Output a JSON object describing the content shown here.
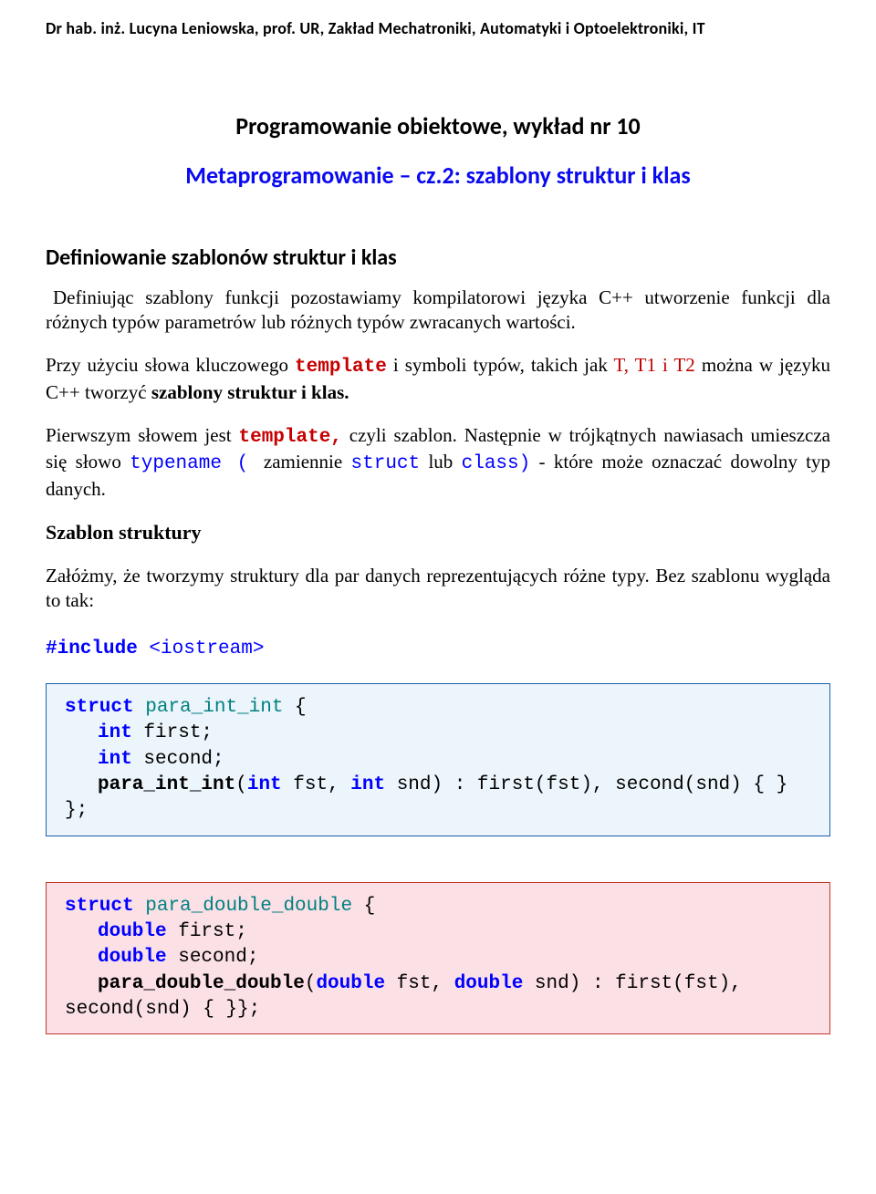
{
  "header": "Dr hab. inż. Lucyna Leniowska, prof. UR, Zakład Mechatroniki, Automatyki i Optoelektroniki, IT",
  "title": "Programowanie obiektowe, wykład nr 10",
  "subtitle": "Metaprogramowanie – cz.2: szablony struktur i klas",
  "section1": "Definiowanie szablonów struktur i klas",
  "p1": "Definiując szablony funkcji pozostawiamy kompilatorowi języka C++ utworzenie funkcji dla różnych typów parametrów lub różnych typów zwracanych wartości.",
  "p2a": "Przy użyciu słowa kluczowego ",
  "p2_template": "template",
  "p2b": " i symboli typów, takich jak ",
  "p2_sym": "T, T1 i T2",
  "p2c": " można w języku C++  tworzyć ",
  "p2_bold": "szablony struktur i klas.",
  "p3a": "Pierwszym słowem jest ",
  "p3_template": "template,",
  "p3b": " czyli szablon. Następnie w trójkątnych nawiasach umieszcza się słowo ",
  "p3_typename": "typename ( ",
  "p3_mid": " zamiennie ",
  "p3_struct": "struct",
  "p3_lub": " lub ",
  "p3_class": "class)",
  "p3c": " - które może oznaczać dowolny typ danych.",
  "section2": "Szablon struktury",
  "p4": "Załóżmy, że tworzymy struktury dla par danych reprezentujących różne typy. Bez szablonu wygląda to tak:",
  "inc_hash": "#include",
  "inc_io": " <iostream>",
  "box1": {
    "l1_kw": "struct",
    "l1_name": " para_int_int",
    "l1_brace": " {",
    "l2_kw": "int",
    "l2_name": " first;",
    "l3_kw": "int",
    "l3_name": " second;",
    "l4_ctor": "para_int_int",
    "l4_open": "(",
    "l4_kw1": "int",
    "l4_arg1": " fst, ",
    "l4_kw2": "int",
    "l4_arg2": " snd) : first(fst), second(snd) { }",
    "l5": "};"
  },
  "box2": {
    "l1_kw": "struct",
    "l1_name": " para_double_double",
    "l1_brace": " {",
    "l2_kw": "double",
    "l2_name": " first;",
    "l3_kw": "double",
    "l3_name": " second;",
    "l4_ctor": "para_double_double",
    "l4_open": "(",
    "l4_kw1": "double",
    "l4_arg1": " fst, ",
    "l4_kw2": "double",
    "l4_arg2": " snd) : first(fst),",
    "l5": "second(snd) { }};"
  }
}
